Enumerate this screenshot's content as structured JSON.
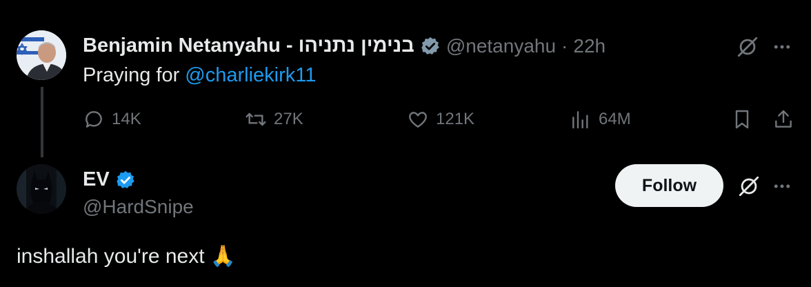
{
  "tweet": {
    "author_name": "Benjamin Netanyahu - בנימין נתניהו",
    "handle": "@netanyahu",
    "separator": "·",
    "time": "22h",
    "text_prefix": "Praying for ",
    "mention": "@charliekirk11",
    "stats": {
      "replies": "14K",
      "reposts": "27K",
      "likes": "121K",
      "views": "64M"
    }
  },
  "reply": {
    "author_name": "EV",
    "handle": "@HardSnipe",
    "follow_label": "Follow",
    "text": "inshallah you're next 🙏"
  },
  "colors": {
    "background": "#000000",
    "text_primary": "#e7e9ea",
    "text_secondary": "#71767b",
    "accent": "#1d9bf0"
  }
}
